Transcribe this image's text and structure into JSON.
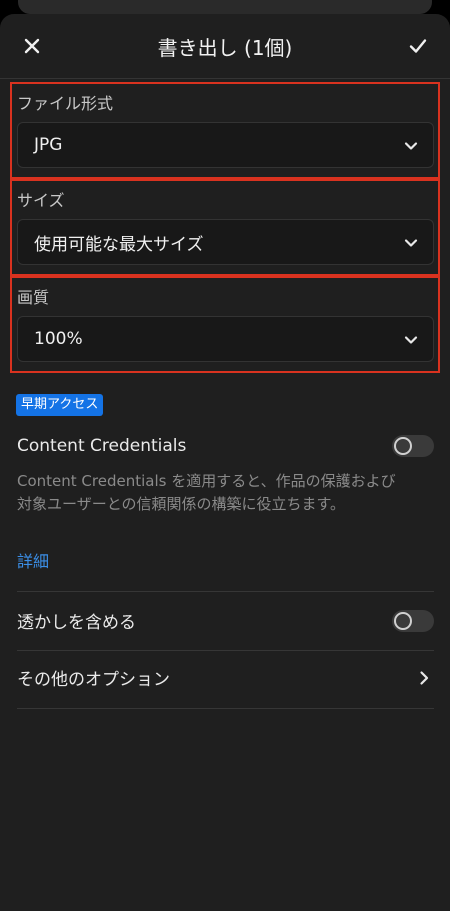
{
  "header": {
    "title": "書き出し (1個)",
    "close_icon": "close-icon",
    "confirm_icon": "checkmark-icon"
  },
  "file_format": {
    "label": "ファイル形式",
    "value": "JPG"
  },
  "size": {
    "label": "サイズ",
    "value": "使用可能な最大サイズ"
  },
  "quality": {
    "label": "画質",
    "value": "100%"
  },
  "early_access": {
    "badge": "早期アクセス"
  },
  "content_credentials": {
    "label": "Content Credentials",
    "enabled": false,
    "description": "Content Credentials を適用すると、作品の保護および対象ユーザーとの信頼関係の構築に役立ちます。",
    "link": "詳細"
  },
  "watermark": {
    "label": "透かしを含める",
    "enabled": false
  },
  "more_options": {
    "label": "その他のオプション"
  },
  "colors": {
    "background": "#1f1f1f",
    "highlight_border": "#d9321f",
    "badge": "#1473e6",
    "link": "#3b8fe8"
  }
}
